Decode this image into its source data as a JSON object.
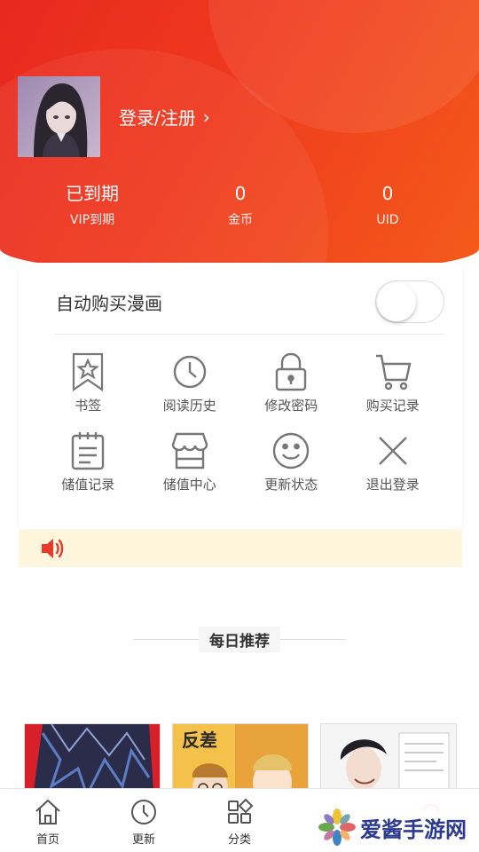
{
  "profile": {
    "login_label": "登录/注册",
    "chevron": "›"
  },
  "stats": [
    {
      "value": "已到期",
      "label": "VIP到期"
    },
    {
      "value": "0",
      "label": "金币"
    },
    {
      "value": "0",
      "label": "UID"
    }
  ],
  "settings": {
    "auto_buy_label": "自动购买漫画",
    "auto_buy_enabled": false
  },
  "menu": [
    {
      "label": "书签",
      "icon": "bookmark-icon"
    },
    {
      "label": "阅读历史",
      "icon": "clock-icon"
    },
    {
      "label": "修改密码",
      "icon": "lock-icon"
    },
    {
      "label": "购买记录",
      "icon": "cart-icon"
    },
    {
      "label": "储值记录",
      "icon": "clipboard-icon"
    },
    {
      "label": "储值中心",
      "icon": "store-icon"
    },
    {
      "label": "更新状态",
      "icon": "smiley-icon"
    },
    {
      "label": "退出登录",
      "icon": "close-icon"
    }
  ],
  "notice": {
    "icon": "speaker-icon",
    "text": ""
  },
  "recommend": {
    "title": "每日推荐"
  },
  "tabs": [
    {
      "label": "首页",
      "icon": "home-icon"
    },
    {
      "label": "更新",
      "icon": "clock-icon"
    },
    {
      "label": "分类",
      "icon": "category-icon"
    },
    {
      "label": "",
      "icon": "ranking-icon"
    },
    {
      "label": "",
      "icon": "profile-icon"
    }
  ],
  "watermark": {
    "text": "爱酱手游网"
  },
  "colors": {
    "brand": "#ec2f1e",
    "brand_light": "#f45b1a",
    "notice_bg": "#fdf6dc"
  }
}
